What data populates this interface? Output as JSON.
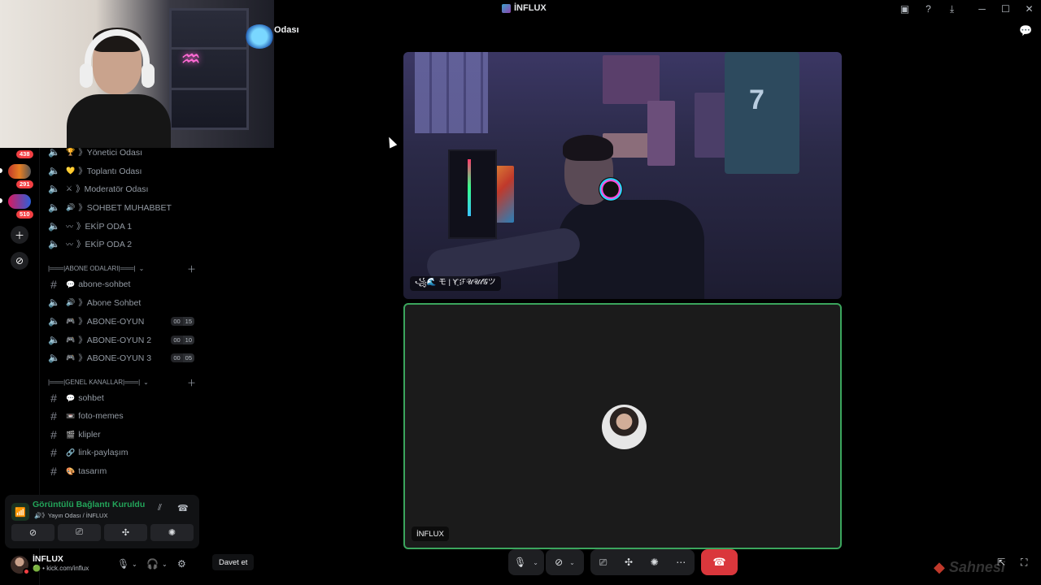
{
  "window": {
    "title": "İNFLUX",
    "icons": [
      "screen-share-icon",
      "help-icon",
      "download-icon",
      "minimize-icon",
      "maximize-icon",
      "close-icon"
    ]
  },
  "channel_title": "Odası",
  "rail": {
    "badges": [
      "438",
      "291",
      "510"
    ]
  },
  "sidebar": {
    "voice_channels_top": [
      {
        "emoji": "🏆",
        "label": "》Yönetici Odası"
      },
      {
        "emoji": "💛",
        "label": "》Toplantı Odası"
      },
      {
        "emoji": "⚔",
        "label": "》Moderatör Odası"
      },
      {
        "emoji": "🔊",
        "label": "》SOHBET MUHABBET"
      },
      {
        "emoji": "〰",
        "label": "》EKİP ODA 1"
      },
      {
        "emoji": "〰",
        "label": "》EKİP ODA 2"
      }
    ],
    "category_abone": "|═══|ABONE ODALARI|═══|",
    "abone_channels": [
      {
        "type": "text",
        "emoji": "💬",
        "label": "abone-sohbet"
      },
      {
        "type": "voice",
        "emoji": "🔊",
        "label": "》Abone Sohbet"
      },
      {
        "type": "voice",
        "emoji": "🎮",
        "label": "》ABONE-OYUN",
        "count_a": "00",
        "count_b": "15"
      },
      {
        "type": "voice",
        "emoji": "🎮",
        "label": "》ABONE-OYUN 2",
        "count_a": "00",
        "count_b": "10"
      },
      {
        "type": "voice",
        "emoji": "🎮",
        "label": "》ABONE-OYUN 3",
        "count_a": "00",
        "count_b": "05"
      }
    ],
    "category_genel": "|═══|GENEL KANALLAR|═══|",
    "genel_channels": [
      {
        "emoji": "💬",
        "label": "sohbet"
      },
      {
        "emoji": "📼",
        "label": "foto-memes"
      },
      {
        "emoji": "🎬",
        "label": "klipler"
      },
      {
        "emoji": "🔗",
        "label": "link-paylaşım"
      },
      {
        "emoji": "🎨",
        "label": "tasarım"
      }
    ]
  },
  "voice_panel": {
    "status": "Görüntülü Bağlantı Kuruldu",
    "sub": "🔊》Yayın Odası / İNFLUX"
  },
  "user_panel": {
    "name": "İNFLUX",
    "sub": "kick.com/influx"
  },
  "video": {
    "top_tile_name": "꧁🌊 モ | Y҈ ℱ𝒰𝒰𝓁𝒢ツ",
    "bottom_tile_name": "İNFLUX"
  },
  "controls": {
    "invite_label": "Davet et"
  },
  "watermark": "Sahnesi",
  "colors": {
    "connected_green": "#23a55a",
    "speaking_border": "#3ba55d",
    "hangup_red": "#da373c",
    "badge_red": "#f23f43"
  }
}
